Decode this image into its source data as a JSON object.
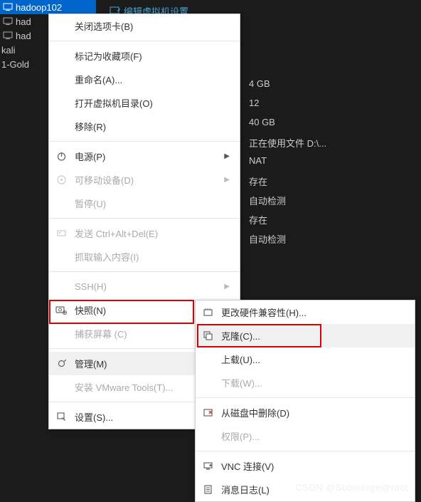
{
  "sidebar": {
    "items": [
      {
        "label": "hadoop102",
        "selected": true
      },
      {
        "label": "had"
      },
      {
        "label": "had"
      },
      {
        "label": "kali"
      },
      {
        "label": "1-Gold"
      }
    ]
  },
  "toolbar": {
    "edit_vm_settings": "编辑虚拟机设置"
  },
  "properties": {
    "rows": [
      "4 GB",
      "12",
      "40 GB",
      "正在使用文件 D:\\...",
      "NAT",
      "存在",
      "自动检测",
      "存在",
      "自动检测"
    ]
  },
  "menu1": {
    "items": [
      {
        "label": "关闭选项卡(B)",
        "icon": ""
      },
      {
        "sep": true
      },
      {
        "label": "标记为收藏项(F)",
        "icon": ""
      },
      {
        "label": "重命名(A)...",
        "icon": ""
      },
      {
        "label": "打开虚拟机目录(O)",
        "icon": ""
      },
      {
        "label": "移除(R)",
        "icon": ""
      },
      {
        "sep": true
      },
      {
        "label": "电源(P)",
        "icon": "power",
        "submenu": true
      },
      {
        "label": "可移动设备(D)",
        "icon": "device",
        "submenu": true,
        "disabled": true
      },
      {
        "label": "暂停(U)",
        "icon": "",
        "disabled": true
      },
      {
        "sep": true
      },
      {
        "label": "发送 Ctrl+Alt+Del(E)",
        "icon": "send",
        "disabled": true
      },
      {
        "label": "抓取输入内容(I)",
        "icon": "",
        "disabled": true
      },
      {
        "sep": true
      },
      {
        "label": "SSH(H)",
        "icon": "",
        "submenu": true,
        "disabled": true
      },
      {
        "label": "快照(N)",
        "icon": "snapshot",
        "submenu": true
      },
      {
        "label": "捕获屏幕 (C)",
        "icon": "",
        "disabled": true
      },
      {
        "sep": true
      },
      {
        "label": "管理(M)",
        "icon": "manage",
        "submenu": true,
        "hover": true
      },
      {
        "label": "安装 VMware Tools(T)...",
        "icon": "",
        "disabled": true
      },
      {
        "sep": true
      },
      {
        "label": "设置(S)...",
        "icon": "settings"
      }
    ]
  },
  "menu2": {
    "items": [
      {
        "label": "更改硬件兼容性(H)...",
        "icon": "hardware"
      },
      {
        "label": "克隆(C)...",
        "icon": "clone",
        "hover": true
      },
      {
        "label": "上载(U)...",
        "icon": ""
      },
      {
        "label": "下载(W)...",
        "icon": "",
        "disabled": true
      },
      {
        "sep": true
      },
      {
        "label": "从磁盘中删除(D)",
        "icon": "delete"
      },
      {
        "label": "权限(P)...",
        "icon": "",
        "disabled": true
      },
      {
        "sep": true
      },
      {
        "label": "VNC 连接(V)",
        "icon": "vnc"
      },
      {
        "label": "消息日志(L)",
        "icon": "log"
      }
    ]
  },
  "watermark": "CSDN @Submerge@root"
}
